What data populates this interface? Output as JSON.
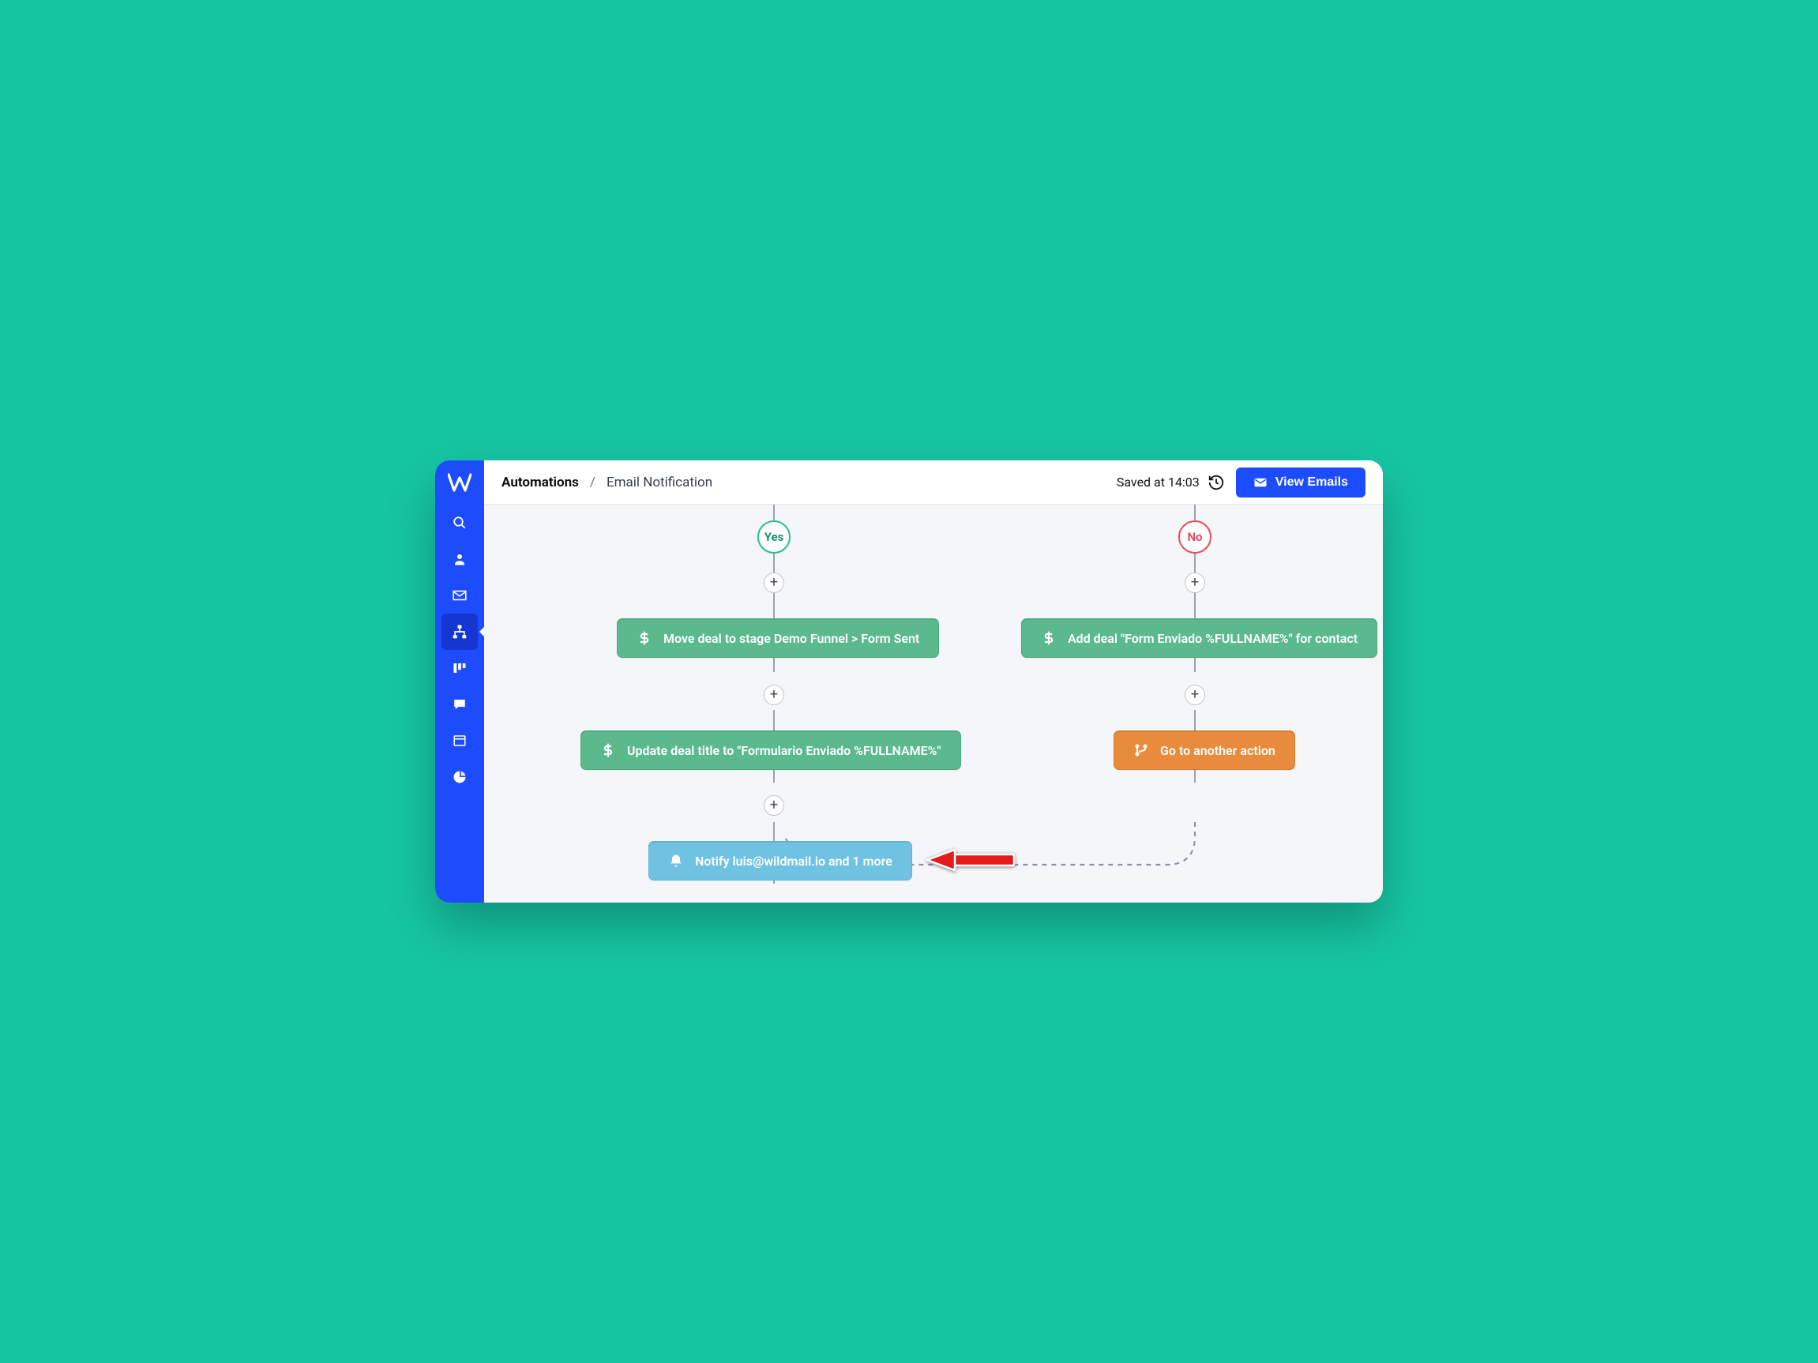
{
  "breadcrumb": {
    "root": "Automations",
    "sep": "/",
    "page": "Email Notification"
  },
  "header": {
    "saved": "Saved at 14:03",
    "view_emails": "View Emails"
  },
  "sidebar": {
    "items": [
      {
        "name": "search"
      },
      {
        "name": "contacts"
      },
      {
        "name": "email"
      },
      {
        "name": "automations",
        "active": true
      },
      {
        "name": "columns"
      },
      {
        "name": "chat"
      },
      {
        "name": "forms"
      },
      {
        "name": "reports"
      }
    ]
  },
  "flow": {
    "yes_label": "Yes",
    "no_label": "No",
    "nodes": {
      "n1": "Move deal to stage Demo Funnel > Form Sent",
      "n2": "Update deal title to \"Formulario Enviado %FULLNAME%\"",
      "n3": "Notify luis@wildmail.io and 1 more",
      "n4": "Add deal \"Form Enviado %FULLNAME%\" for contact",
      "n5": "Go to another action"
    }
  }
}
